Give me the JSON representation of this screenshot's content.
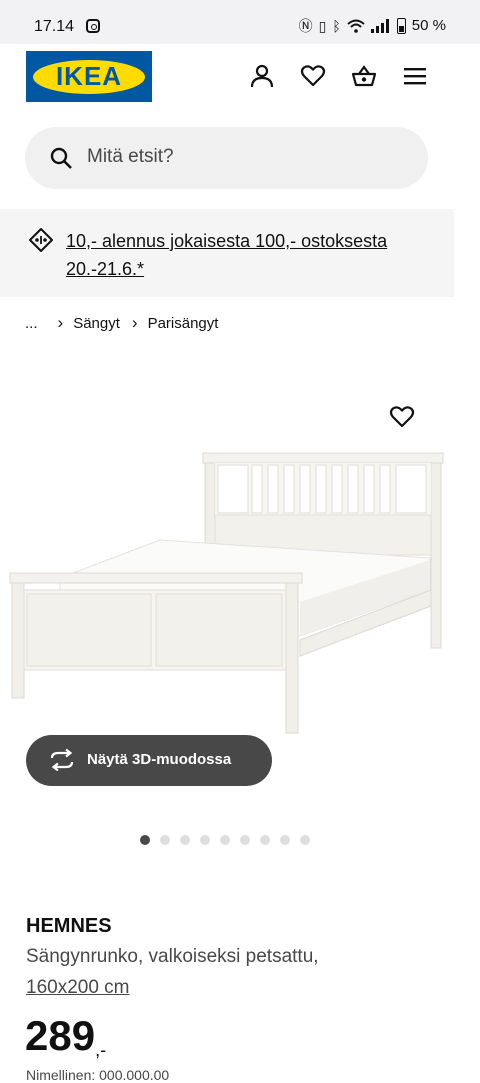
{
  "status_bar": {
    "time": "17.14",
    "battery": "50 %"
  },
  "header": {
    "logo_text": "IKEA",
    "icons": [
      "account-icon",
      "heart-icon",
      "basket-icon",
      "menu-icon"
    ]
  },
  "search": {
    "placeholder": "Mitä etsit?"
  },
  "promo": {
    "text": "10,- alennus jokaisesta 100,- ostoksesta 20.-21.6.*"
  },
  "breadcrumb": {
    "ellipsis": "...",
    "items": [
      "Sängyt",
      "Parisängyt"
    ]
  },
  "gallery": {
    "button_3d": "Näytä 3D-muodossa",
    "image_count": 9,
    "active_index": 0
  },
  "product": {
    "name": "HEMNES",
    "description": "Sängynrunko, valkoiseksi petsattu,",
    "size": "160x200 cm",
    "price": "289",
    "price_suffix": ",-",
    "article": "Nimellinen: 000.000.00"
  },
  "colors": {
    "ikea_blue": "#0058a3",
    "ikea_yellow": "#ffdb00",
    "button_dark": "#484848"
  }
}
